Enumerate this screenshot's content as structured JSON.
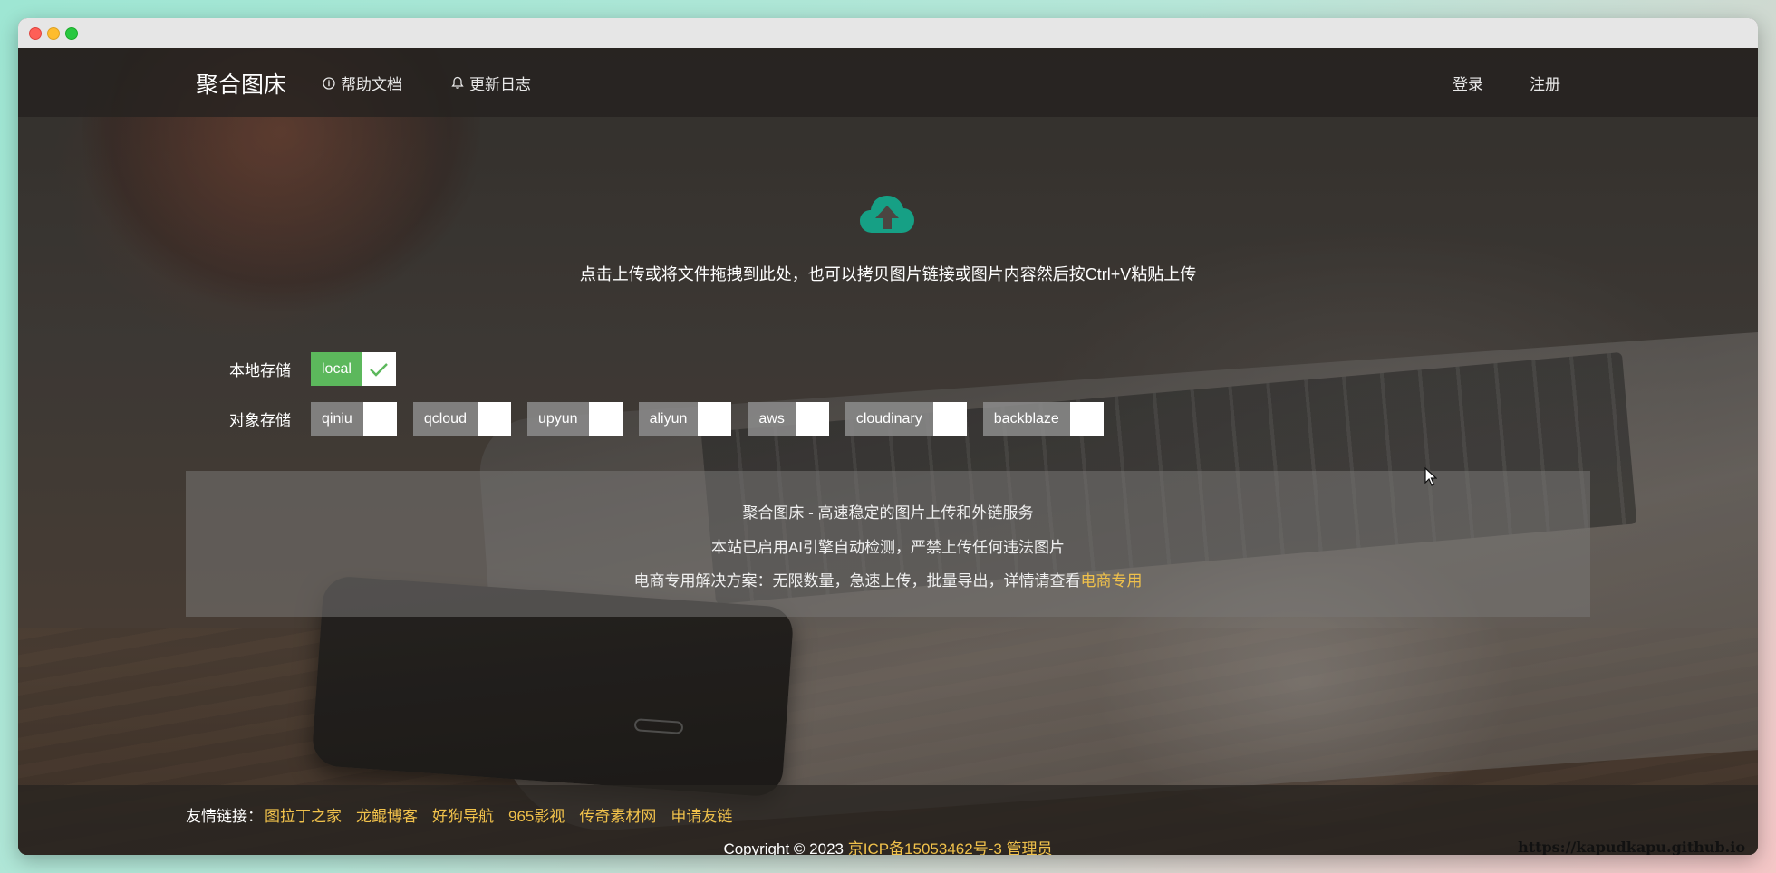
{
  "nav": {
    "brand": "聚合图床",
    "help_label": "帮助文档",
    "changelog_label": "更新日志",
    "login_label": "登录",
    "register_label": "注册"
  },
  "upload": {
    "icon": "cloud-upload-icon",
    "tip": "点击上传或将文件拖拽到此处，也可以拷贝图片链接或图片内容然后按Ctrl+V粘贴上传"
  },
  "storage": {
    "local_label": "本地存储",
    "object_label": "对象存储",
    "local_options": [
      {
        "name": "local",
        "checked": true
      }
    ],
    "object_options": [
      {
        "name": "qiniu",
        "checked": false
      },
      {
        "name": "qcloud",
        "checked": false
      },
      {
        "name": "upyun",
        "checked": false
      },
      {
        "name": "aliyun",
        "checked": false
      },
      {
        "name": "aws",
        "checked": false
      },
      {
        "name": "cloudinary",
        "checked": false
      },
      {
        "name": "backblaze",
        "checked": false
      }
    ]
  },
  "info": {
    "line1": "聚合图床 - 高速稳定的图片上传和外链服务",
    "line2": "本站已启用AI引擎自动检测，严禁上传任何违法图片",
    "line3_prefix": "电商专用解决方案：无限数量，急速上传，批量导出，详情请查看",
    "line3_link": "电商专用"
  },
  "footer": {
    "links_label": "友情链接：",
    "links": [
      "图拉丁之家",
      "龙鲲博客",
      "好狗导航",
      "965影视",
      "传奇素材网",
      "申请友链"
    ],
    "copyright_prefix": "Copyright © 2023 ",
    "icp": "京ICP备15053462号-3",
    "admin": "管理员",
    "watermark": "https://kapudkapu.github.io"
  },
  "colors": {
    "accent_green": "#5cb85c",
    "link_yellow": "#f0c14b",
    "upload_teal": "#16a085"
  }
}
